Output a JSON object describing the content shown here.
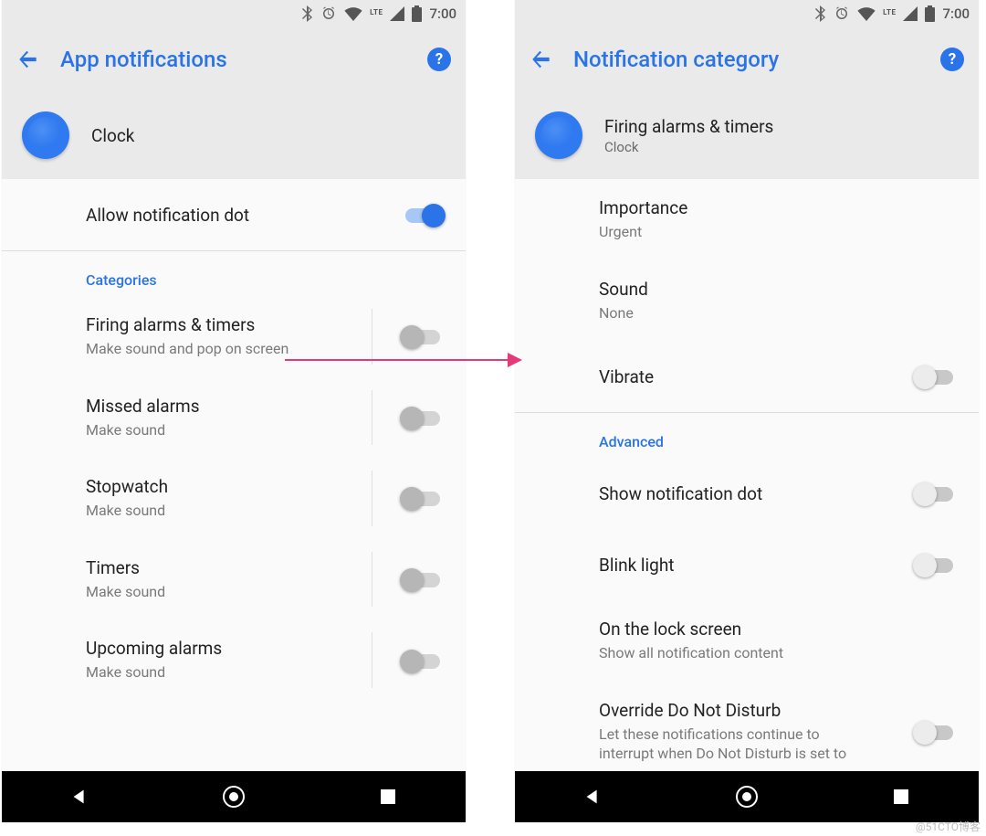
{
  "status": {
    "time": "7:00",
    "lte": "LTE"
  },
  "left": {
    "title": "App notifications",
    "app_name": "Clock",
    "allow_dot": {
      "label": "Allow notification dot",
      "on": true
    },
    "categories_header": "Categories",
    "categories": [
      {
        "title": "Firing alarms & timers",
        "subtitle": "Make sound and pop on screen"
      },
      {
        "title": "Missed alarms",
        "subtitle": "Make sound"
      },
      {
        "title": "Stopwatch",
        "subtitle": "Make sound"
      },
      {
        "title": "Timers",
        "subtitle": "Make sound"
      },
      {
        "title": "Upcoming alarms",
        "subtitle": "Make sound"
      }
    ]
  },
  "right": {
    "title": "Notification category",
    "channel_title": "Firing alarms & timers",
    "app_name": "Clock",
    "importance": {
      "label": "Importance",
      "value": "Urgent"
    },
    "sound": {
      "label": "Sound",
      "value": "None"
    },
    "vibrate": {
      "label": "Vibrate"
    },
    "advanced_header": "Advanced",
    "show_dot": {
      "label": "Show notification dot"
    },
    "blink": {
      "label": "Blink light"
    },
    "lockscreen": {
      "label": "On the lock screen",
      "value": "Show all notification content"
    },
    "override": {
      "label": "Override Do Not Disturb",
      "subtitle": "Let these notifications continue to interrupt when Do Not Disturb is set to"
    }
  },
  "watermark": "@51CTO博客"
}
